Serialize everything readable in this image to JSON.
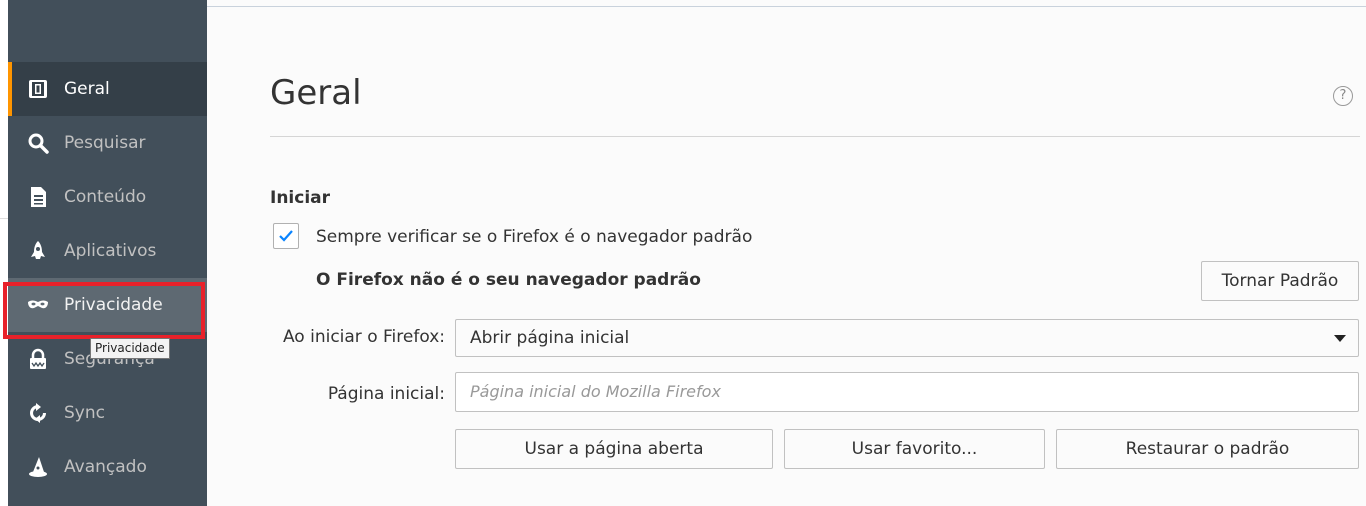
{
  "sidebar": {
    "items": [
      {
        "label": "Geral",
        "icon": "general-icon",
        "state": "selected"
      },
      {
        "label": "Pesquisar",
        "icon": "search-icon",
        "state": "normal"
      },
      {
        "label": "Conteúdo",
        "icon": "document-icon",
        "state": "normal"
      },
      {
        "label": "Aplicativos",
        "icon": "rocket-icon",
        "state": "normal"
      },
      {
        "label": "Privacidade",
        "icon": "mask-icon",
        "state": "hover"
      },
      {
        "label": "Segurança",
        "icon": "lock-icon",
        "state": "normal"
      },
      {
        "label": "Sync",
        "icon": "sync-icon",
        "state": "normal"
      },
      {
        "label": "Avançado",
        "icon": "wizard-hat-icon",
        "state": "normal"
      }
    ],
    "tooltip": "Privacidade",
    "accent_color": "#ff9500",
    "highlight_color": "#e8212a"
  },
  "main": {
    "title": "Geral",
    "help_glyph": "?",
    "startup": {
      "heading": "Iniciar",
      "always_check": {
        "label": "Sempre verificar se o Firefox é o navegador padrão",
        "checked": true
      },
      "not_default_text": "O Firefox não é o seu navegador padrão",
      "make_default_button": "Tornar Padrão",
      "when_starts_label": "Ao iniciar o Firefox:",
      "when_starts_value": "Abrir página inicial",
      "homepage_label": "Página inicial:",
      "homepage_placeholder": "Página inicial do Mozilla Firefox",
      "use_current_button": "Usar a página aberta",
      "use_bookmark_button": "Usar favorito...",
      "restore_default_button": "Restaurar o padrão"
    }
  }
}
